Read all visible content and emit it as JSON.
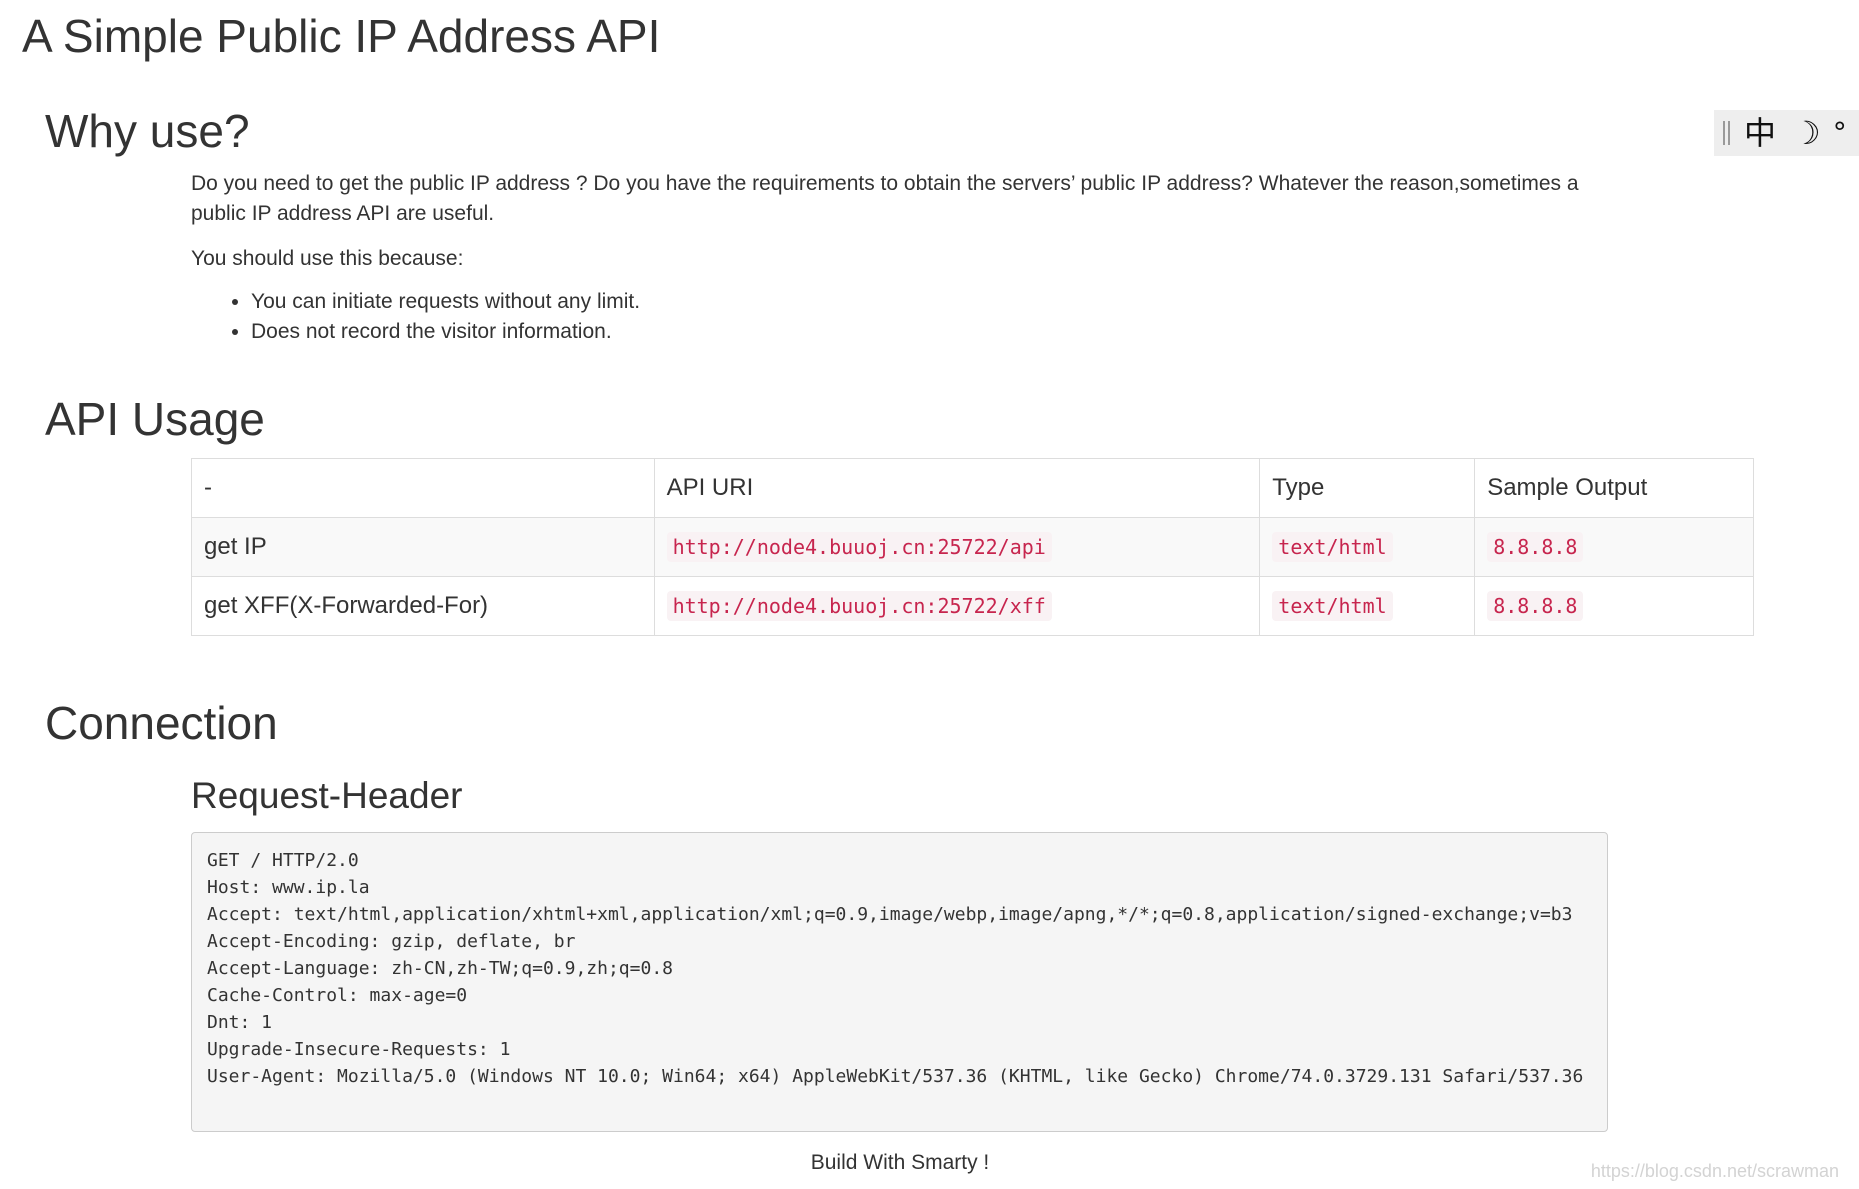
{
  "page_title": "A Simple Public IP Address API",
  "toolbar": {
    "chinese_label": "中",
    "moon_glyph": "☽",
    "degree_glyph": "°"
  },
  "why": {
    "heading": "Why use?",
    "intro": "Do you need to get the public IP address ? Do you have the requirements to obtain the servers’ public IP address? Whatever the reason,sometimes a public IP address API are useful.",
    "because": "You should use this because:",
    "reasons": [
      "You can initiate requests without any limit.",
      "Does not record the visitor information."
    ]
  },
  "api_usage": {
    "heading": "API Usage",
    "columns": [
      "-",
      "API URI",
      "Type",
      "Sample Output"
    ],
    "rows": [
      {
        "name": "get IP",
        "uri": "http://node4.buuoj.cn:25722/api",
        "type": "text/html",
        "output": "8.8.8.8"
      },
      {
        "name": "get XFF(X-Forwarded-For)",
        "uri": "http://node4.buuoj.cn:25722/xff",
        "type": "text/html",
        "output": "8.8.8.8"
      }
    ]
  },
  "connection": {
    "heading": "Connection",
    "subheading": "Request-Header",
    "header_lines": [
      "GET / HTTP/2.0",
      "Host: www.ip.la",
      "Accept: text/html,application/xhtml+xml,application/xml;q=0.9,image/webp,image/apng,*/*;q=0.8,application/signed-exchange;v=b3",
      "Accept-Encoding: gzip, deflate, br",
      "Accept-Language: zh-CN,zh-TW;q=0.9,zh;q=0.8",
      "Cache-Control: max-age=0",
      "Dnt: 1",
      "Upgrade-Insecure-Requests: 1",
      "User-Agent: Mozilla/5.0 (Windows NT 10.0; Win64; x64) AppleWebKit/537.36 (KHTML, like Gecko) Chrome/74.0.3729.131 Safari/537.36"
    ]
  },
  "footer": "Build With Smarty !",
  "watermark": "https://blog.csdn.net/scrawman",
  "colors": {
    "code_text": "#c7254e",
    "code_bg": "#f9f2f4",
    "pre_bg": "#f5f5f5",
    "table_stripe": "#f9f9f9",
    "text": "#333333"
  }
}
